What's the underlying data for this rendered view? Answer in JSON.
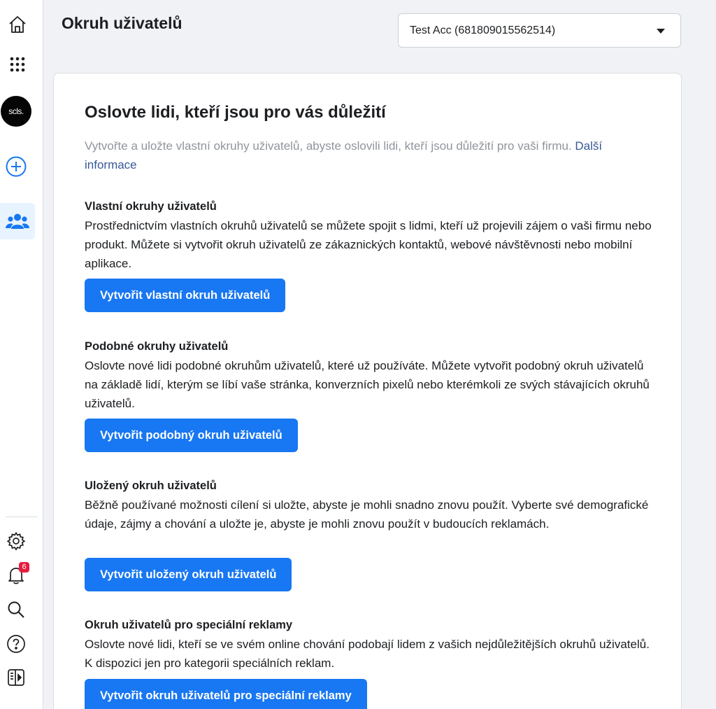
{
  "header": {
    "title": "Okruh uživatelů",
    "account_select_value": "Test Acc (681809015562514)"
  },
  "rail": {
    "avatar_text": "scls.",
    "notifications_count": "6",
    "icons": [
      "home-icon",
      "apps-grid-icon",
      "account-avatar",
      "create-plus-icon",
      "audiences-icon",
      "settings-icon",
      "notifications-bell-icon",
      "search-icon",
      "help-icon",
      "toggle-panel-icon"
    ]
  },
  "card": {
    "headline": "Oslovte lidi, kteří jsou pro vás důležití",
    "intro_text": "Vytvořte a uložte vlastní okruhy uživatelů, abyste oslovili lidi, kteří jsou důležití pro vaši firmu.",
    "learn_more_link": "Další informace",
    "sections": [
      {
        "title": "Vlastní okruhy uživatelů",
        "description": "Prostřednictvím vlastních okruhů uživatelů se můžete spojit s lidmi, kteří už projevili zájem o vaši firmu nebo produkt. Můžete si vytvořit okruh uživatelů ze zákaznických kontaktů, webové návštěvnosti nebo mobilní aplikace.",
        "button_label": "Vytvořit vlastní okruh uživatelů"
      },
      {
        "title": "Podobné okruhy uživatelů",
        "description": "Oslovte nové lidi podobné okruhům uživatelů, které už používáte. Můžete vytvořit podobný okruh uživatelů na základě lidí, kterým se líbí vaše stránka, konverzních pixelů nebo kterémkoli ze svých stávajících okruhů uživatelů.",
        "button_label": "Vytvořit podobný okruh uživatelů"
      },
      {
        "title": "Uložený okruh uživatelů",
        "description": "Běžně používané možnosti cílení si uložte, abyste je mohli snadno znovu použít. Vyberte své demografické údaje, zájmy a chování a uložte je, abyste je mohli znovu použít v budoucích reklamách.",
        "button_label": "Vytvořit uložený okruh uživatelů"
      },
      {
        "title": "Okruh uživatelů pro speciální reklamy",
        "description": "Oslovte nové lidi, kteří se ve svém online chování podobají lidem z vašich nejdůležitějších okruhů uživatelů. K dispozici jen pro kategorii speciálních reklam.",
        "button_label": "Vytvořit okruh uživatelů pro speciální reklamy"
      }
    ]
  },
  "colors": {
    "primary_button": "#1877f2",
    "link": "#385898",
    "muted_text": "#90949c",
    "page_background": "#f0f2f5",
    "badge": "#e41e3f"
  }
}
